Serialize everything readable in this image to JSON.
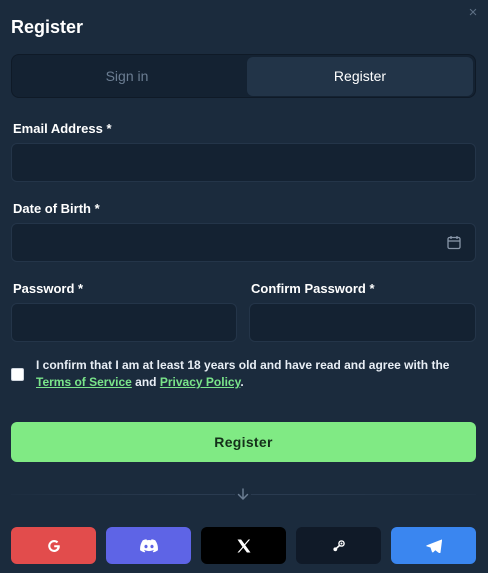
{
  "modal": {
    "title": "Register",
    "close_glyph": "×"
  },
  "tabs": {
    "sign_in": "Sign in",
    "register": "Register",
    "active": "register"
  },
  "form": {
    "email_label": "Email Address *",
    "email_value": "",
    "dob_label": "Date of Birth *",
    "dob_value": "",
    "password_label": "Password *",
    "password_value": "",
    "confirm_label": "Confirm Password *",
    "confirm_value": ""
  },
  "consent": {
    "checked": false,
    "text_before": "I confirm that I am at least 18 years old and have read and agree with the",
    "terms_link": "Terms of Service",
    "and": "and",
    "privacy_link": "Privacy Policy",
    "period": "."
  },
  "submit_label": "Register",
  "socials": [
    {
      "name": "google",
      "icon": "google-icon",
      "color": "#e24c4c"
    },
    {
      "name": "discord",
      "icon": "discord-icon",
      "color": "#5e64e6"
    },
    {
      "name": "x",
      "icon": "x-icon",
      "color": "#000000"
    },
    {
      "name": "steam",
      "icon": "steam-icon",
      "color": "#101a28"
    },
    {
      "name": "telegram",
      "icon": "telegram-icon",
      "color": "#3a86f0"
    }
  ],
  "colors": {
    "background": "#1b2b3d",
    "input_bg": "#142232",
    "accent_green": "#80ea84",
    "link_green": "#7ae58a"
  }
}
